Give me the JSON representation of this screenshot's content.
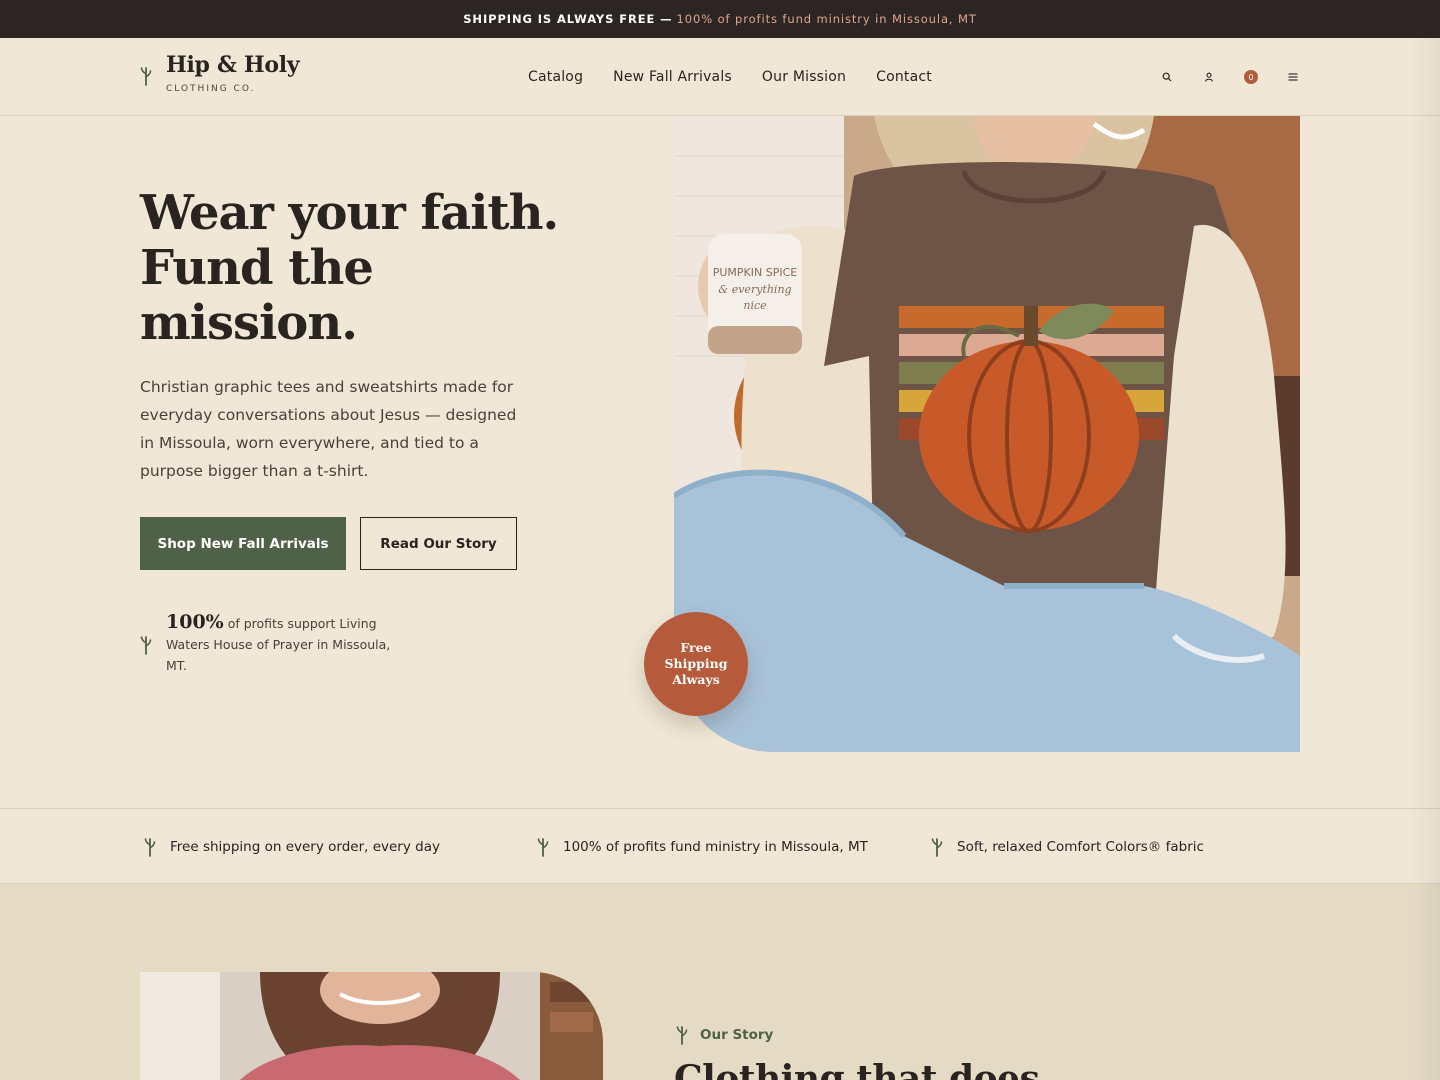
{
  "announcement": {
    "bold": "SHIPPING IS ALWAYS FREE —",
    "accent": "100% of profits fund ministry in Missoula, MT"
  },
  "header": {
    "logo_name": "Hip & Holy",
    "logo_sub": "CLOTHING CO.",
    "nav": [
      "Catalog",
      "New Fall Arrivals",
      "Our Mission",
      "Contact"
    ],
    "icons": [
      "search-icon",
      "account-icon",
      "cart-icon",
      "menu-icon"
    ],
    "cart_count": "0"
  },
  "hero": {
    "title_lines": [
      "Wear your faith.",
      "Fund the",
      "mission."
    ],
    "description": "Christian graphic tees and sweatshirts made for everyday conversations about Jesus — designed in Missoula, worn everywhere, and tied to a purpose bigger than a t-shirt.",
    "primary_cta": "Shop New Fall Arrivals",
    "secondary_cta": "Read Our Story",
    "stat_number": "100%",
    "stat_text": "of profits support Living Waters House of Prayer in Missoula, MT.",
    "badge_lines": [
      "Free",
      "Shipping",
      "Always"
    ],
    "image": {
      "mug_text": [
        "PUMPKIN SPICE",
        "& everything",
        "nice"
      ]
    }
  },
  "features": [
    "Free shipping on every order, every day",
    "100% of profits fund ministry in Missoula, MT",
    "Soft, relaxed Comfort Colors® fabric"
  ],
  "story": {
    "eyebrow": "Our Story",
    "title": "Clothing that does"
  },
  "colors": {
    "background": "#f0e7d7",
    "dark": "#2b2623",
    "accent_rust": "#b55a3a",
    "accent_green": "#4f6147",
    "story_bg": "#e5dbc5"
  }
}
